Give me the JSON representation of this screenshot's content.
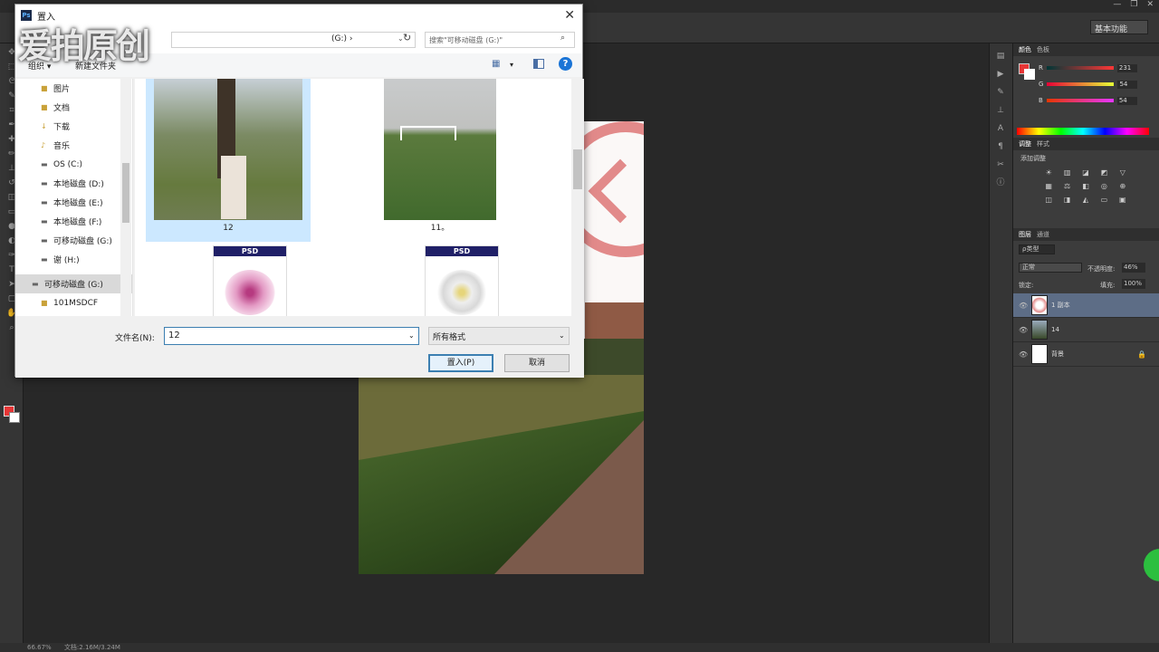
{
  "ps": {
    "workspace": "基本功能",
    "status_zoom": "66.67%",
    "status_doc": "文档:2.16M/3.24M",
    "panels": {
      "color_tabs": [
        "颜色",
        "色板"
      ],
      "r_label": "R",
      "r_value": "231",
      "g_label": "G",
      "g_value": "54",
      "b_label": "B",
      "b_value": "54",
      "adj_tabs": [
        "调整",
        "样式"
      ],
      "adj_title": "添加调整",
      "layers_tabs": [
        "图层",
        "通道"
      ],
      "kind_filter": "ρ类型",
      "blend_mode": "正常",
      "opacity_label": "不透明度:",
      "opacity_value": "46%",
      "lock_label": "锁定:",
      "fill_label": "填充:",
      "fill_value": "100%",
      "layers": [
        {
          "name": "1 副本"
        },
        {
          "name": "14"
        },
        {
          "name": "背景"
        }
      ]
    }
  },
  "watermark": "爱拍原创",
  "dialog": {
    "title": "置入",
    "address": "(G:) ›",
    "search_placeholder": "搜索\"可移动磁盘 (G:)\"",
    "organize": "组织 ▾",
    "new_folder": "新建文件夹",
    "nav_items": [
      {
        "label": "图片",
        "icon": "folder-icon"
      },
      {
        "label": "文档",
        "icon": "folder-icon"
      },
      {
        "label": "下载",
        "icon": "folder-icon"
      },
      {
        "label": "音乐",
        "icon": "folder-icon"
      },
      {
        "label": "OS (C:)",
        "icon": "drive-icon"
      },
      {
        "label": "本地磁盘 (D:)",
        "icon": "drive-icon"
      },
      {
        "label": "本地磁盘 (E:)",
        "icon": "drive-icon"
      },
      {
        "label": "本地磁盘 (F:)",
        "icon": "drive-icon"
      },
      {
        "label": "可移动磁盘 (G:)",
        "icon": "drive-icon"
      },
      {
        "label": "谢 (H:)",
        "icon": "drive-icon"
      },
      {
        "label": "可移动磁盘 (G:)",
        "icon": "drive-icon"
      },
      {
        "label": "101MSDCF",
        "icon": "folder-icon"
      }
    ],
    "files": [
      {
        "label": "12"
      },
      {
        "label": "11。"
      },
      {
        "label": "",
        "badge": "PSD"
      },
      {
        "label": "",
        "badge": "PSD"
      }
    ],
    "filename_label": "文件名(N):",
    "filename_value": "12",
    "filter_value": "所有格式",
    "place_button": "置入(P)",
    "cancel_button": "取消"
  }
}
